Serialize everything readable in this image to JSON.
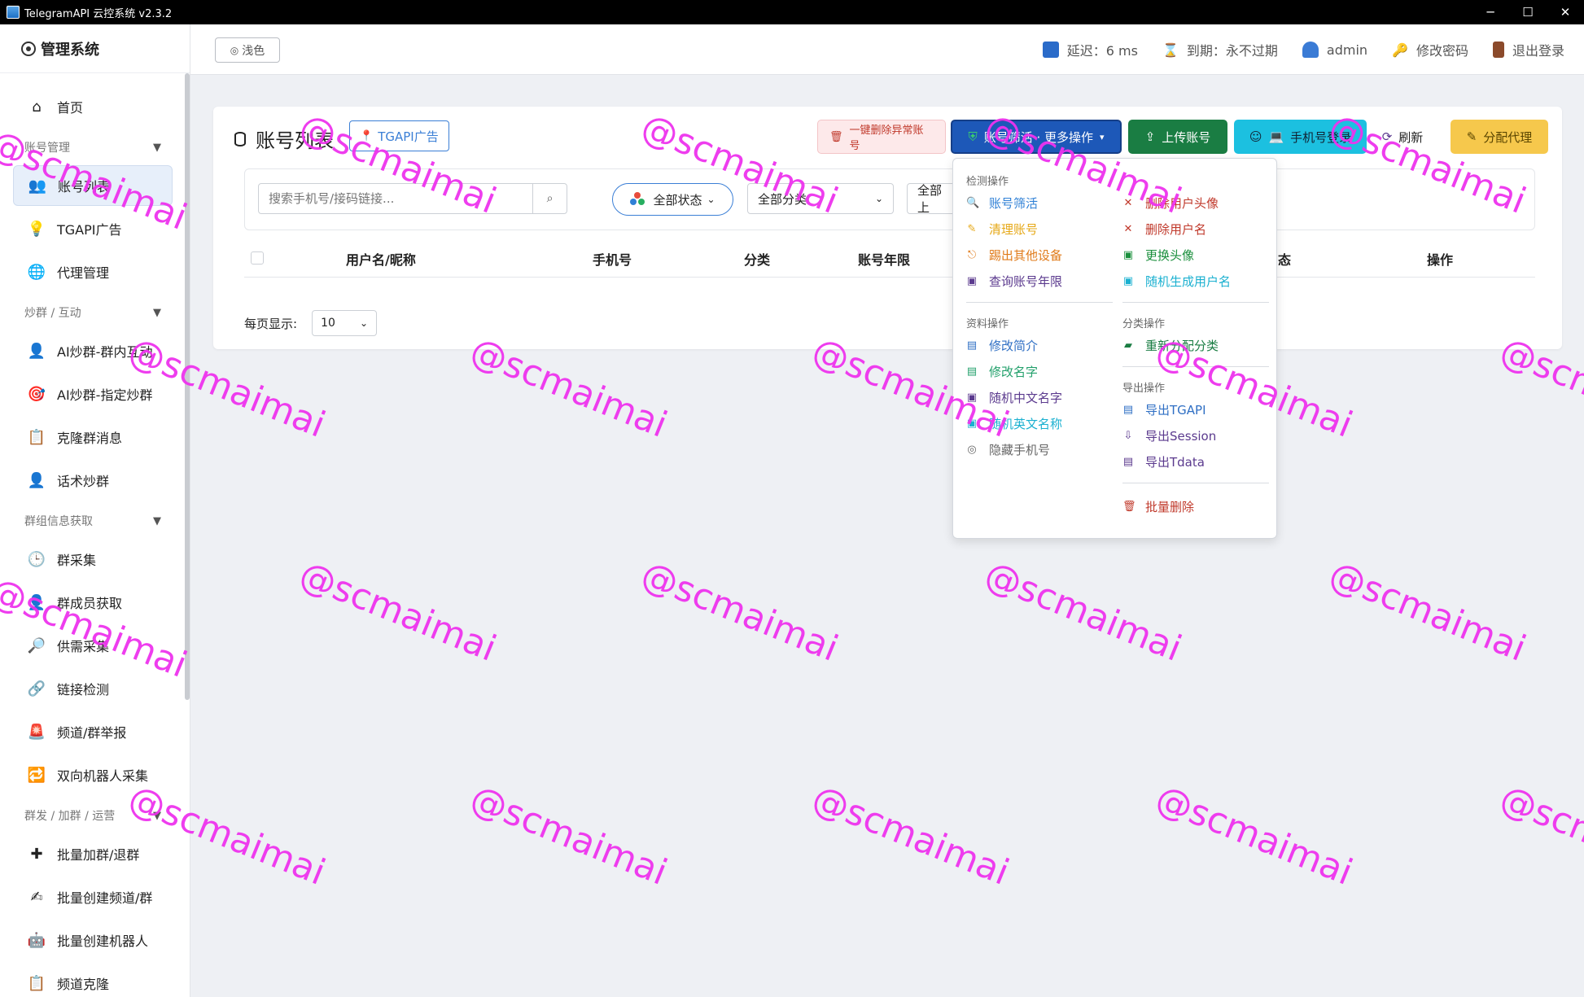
{
  "window": {
    "title": "TelegramAPI 云控系统 v2.3.2",
    "controls": [
      "─",
      "☐",
      "✕"
    ]
  },
  "sidebar": {
    "brand": "管理系统",
    "items": [
      {
        "label": "首页",
        "icon": "home-icon",
        "glyph": "⌂"
      },
      {
        "group": "账号管理",
        "caret": "▼"
      },
      {
        "label": "账号列表",
        "icon": "users-icon",
        "glyph": "👥",
        "active": true
      },
      {
        "label": "TGAPI广告",
        "icon": "bulb-icon",
        "glyph": "💡"
      },
      {
        "label": "代理管理",
        "icon": "globe-icon",
        "glyph": "🌐"
      },
      {
        "group": "炒群 / 互动",
        "caret": "▼"
      },
      {
        "label": "AI炒群-群内互动",
        "icon": "user-chat-icon",
        "glyph": "👤"
      },
      {
        "label": "AI炒群-指定炒群",
        "icon": "target-icon",
        "glyph": "🎯"
      },
      {
        "label": "克隆群消息",
        "icon": "clipboard-icon",
        "glyph": "📋"
      },
      {
        "label": "话术炒群",
        "icon": "user-speech-icon",
        "glyph": "👤"
      },
      {
        "group": "群组信息获取",
        "caret": "▼"
      },
      {
        "label": "群采集",
        "icon": "clock-icon",
        "glyph": "🕒"
      },
      {
        "label": "群成员获取",
        "icon": "member-icon",
        "glyph": "👤"
      },
      {
        "label": "供需采集",
        "icon": "magnifier-icon",
        "glyph": "🔎"
      },
      {
        "label": "链接检测",
        "icon": "link-icon",
        "glyph": "🔗"
      },
      {
        "label": "频道/群举报",
        "icon": "alarm-icon",
        "glyph": "🚨"
      },
      {
        "label": "双向机器人采集",
        "icon": "bot-sync-icon",
        "glyph": "🔁"
      },
      {
        "group": "群发 / 加群 / 运营",
        "caret": "▼"
      },
      {
        "label": "批量加群/退群",
        "icon": "plus-icon",
        "glyph": "✚"
      },
      {
        "label": "批量创建频道/群",
        "icon": "create-icon",
        "glyph": "✍"
      },
      {
        "label": "批量创建机器人",
        "icon": "robot-icon",
        "glyph": "🤖"
      },
      {
        "label": "频道克隆",
        "icon": "clone-icon",
        "glyph": "📋"
      }
    ]
  },
  "header": {
    "theme_button": "浅色",
    "latency": "延迟：6 ms",
    "expiry": "到期：永不过期",
    "user": "admin",
    "change_password": "修改密码",
    "logout": "退出登录"
  },
  "main": {
    "title": "账号列表",
    "ad_button": "TGAPI广告",
    "buttons": {
      "delete_abnormal": "一键删除异常账号",
      "filter_more": "账号筛活 · 更多操作",
      "upload": "上传账号",
      "phone_login": "手机号登录",
      "refresh": "刷新",
      "assign_proxy": "分配代理"
    },
    "search": {
      "placeholder": "搜索手机号/接码链接..."
    },
    "status_filter": "全部状态",
    "category_filter": "全部分类",
    "upload_filter": "全部上",
    "table_headers": [
      "用户名/昵称",
      "手机号",
      "分类",
      "账号年限",
      "态",
      "操作"
    ],
    "pager": {
      "label": "每页显示:",
      "value": "10"
    }
  },
  "dropdown": {
    "left": {
      "sections": [
        {
          "title": "检测操作",
          "items": [
            {
              "label": "账号筛活",
              "color": "#2f80d6",
              "glyph": "🔍"
            },
            {
              "label": "清理账号",
              "color": "#e6a817",
              "glyph": "✎"
            },
            {
              "label": "踢出其他设备",
              "color": "#e07b1a",
              "glyph": "⎋"
            },
            {
              "label": "查询账号年限",
              "color": "#5b3a8e",
              "glyph": "▣"
            }
          ]
        },
        {
          "title": "资料操作",
          "items": [
            {
              "label": "修改简介",
              "color": "#2f6fc4",
              "glyph": "▤"
            },
            {
              "label": "修改名字",
              "color": "#22a06b",
              "glyph": "▤"
            },
            {
              "label": "随机中文名字",
              "color": "#5b3a8e",
              "glyph": "▣"
            },
            {
              "label": "随机英文名称",
              "color": "#1ab0d0",
              "glyph": "▣"
            },
            {
              "label": "隐藏手机号",
              "color": "#666666",
              "glyph": "◎"
            }
          ]
        }
      ]
    },
    "right": {
      "sections": [
        {
          "title": "",
          "items": [
            {
              "label": "删除用户头像",
              "color": "#c0392b",
              "glyph": "✕"
            },
            {
              "label": "删除用户名",
              "color": "#c0392b",
              "glyph": "✕"
            },
            {
              "label": "更换头像",
              "color": "#1a8f3c",
              "glyph": "▣"
            },
            {
              "label": "随机生成用户名",
              "color": "#1ab0d0",
              "glyph": "▣"
            }
          ]
        },
        {
          "title": "分类操作",
          "items": [
            {
              "label": "重新分配分类",
              "color": "#1a7d43",
              "glyph": "▰"
            }
          ]
        },
        {
          "title": "导出操作",
          "items": [
            {
              "label": "导出TGAPI",
              "color": "#2f6fc4",
              "glyph": "▤"
            },
            {
              "label": "导出Session",
              "color": "#5b3a8e",
              "glyph": "⇩"
            },
            {
              "label": "导出Tdata",
              "color": "#5b3a8e",
              "glyph": "▤"
            }
          ]
        },
        {
          "title": "",
          "items": [
            {
              "label": "批量删除",
              "color": "#c0392b",
              "glyph": "🗑"
            }
          ]
        }
      ]
    }
  },
  "watermark": "@scmaimai"
}
